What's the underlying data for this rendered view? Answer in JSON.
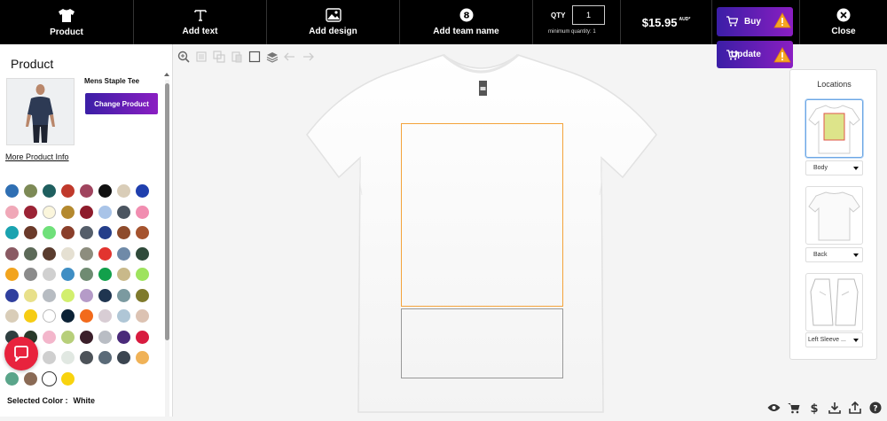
{
  "topbar": {
    "product": "Product",
    "add_text": "Add text",
    "add_design": "Add design",
    "add_team_name": "Add team name",
    "qty_label": "QTY",
    "qty_value": "1",
    "min_qty": "minimum quantity: 1",
    "price": "$15.95",
    "currency": "AUD*",
    "buy": "Buy",
    "update": "Update",
    "close": "Close"
  },
  "left": {
    "title": "Product",
    "product_name": "Mens Staple Tee",
    "change_product": "Change Product",
    "more_info": "More Product Info",
    "selected_color_label": "Selected Color :",
    "selected_color_value": "White",
    "swatch_colors": [
      [
        "#2f6fb3",
        "#7d8a56",
        "#1f5f5f",
        "#c0392b",
        "#a0445e",
        "#111111",
        "#d9cdb8",
        "#1f3fae"
      ],
      [
        "#f0a8b8",
        "#9b2335",
        "#fbf6dc",
        "#b4892f",
        "#8e1c2c",
        "#a9c4e8",
        "#4b5560",
        "#f18db0"
      ],
      [
        "#1aa3b0",
        "#6b3a2a",
        "#6fe07a",
        "#8a3f2b",
        "#555e6a",
        "#243e8a",
        "#8e4b2b",
        "#a5532e"
      ],
      [
        "#8a5a63",
        "#5c6a58",
        "#5a3c2e",
        "#e5e0d2",
        "#8d8d7e",
        "#e2342f",
        "#6f8aa8",
        "#2f4a3a"
      ],
      [
        "#f2a41e",
        "#8b8b8b",
        "#d0d0d0",
        "#3f8ec4",
        "#6f8b72",
        "#12a04b",
        "#c9b98a",
        "#9ee35e"
      ],
      [
        "#2f3f9e",
        "#e8e08a",
        "#b7bcc2",
        "#d2ef6e",
        "#b59bc8",
        "#1f3550",
        "#7b9aa0",
        "#7f7a2c"
      ],
      [
        "#d9cdb8",
        "#f6cc13",
        "#ffffff",
        "#0c2236",
        "#f26a1b",
        "#d8cdd4",
        "#afc6d6",
        "#dcc2b2"
      ],
      [
        "#2f3f40",
        "#2a3a2a",
        "#f3b6cb",
        "#b7cf7a",
        "#3a1f2a",
        "#b9bdc4",
        "#4a2a7a",
        "#d81b3f"
      ],
      [
        "#c0c0c0",
        "#3a3a3a",
        "#cfcfcf",
        "#e1e8e2",
        "#4d5359",
        "#5a6a78",
        "#3b4550",
        "#f0b257"
      ],
      [
        "#5aa58a",
        "#8a6a55",
        "#ffffff",
        "#f8d30e"
      ]
    ]
  },
  "locations": {
    "title": "Locations",
    "items": [
      "Body",
      "Back",
      "Left Sleeve ..."
    ]
  },
  "colors": {
    "accent_start": "#3b1ea6",
    "accent_end": "#8a1ec2",
    "print_area": "#f4a33b",
    "warning": "#f5a623"
  },
  "bottom_icons": [
    "eye-icon",
    "cart-icon",
    "dollar-icon",
    "download-icon",
    "share-icon",
    "help-icon"
  ]
}
